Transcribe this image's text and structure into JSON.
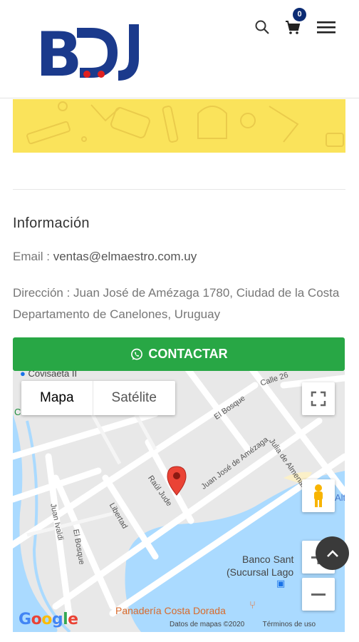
{
  "header": {
    "logo_text": "BDJ",
    "cart_count": "0",
    "icons": [
      "search-icon",
      "cart-icon",
      "hamburger-menu-icon"
    ],
    "brand_colors": {
      "navy": "#1b3a8c",
      "red": "#e0201f"
    }
  },
  "banner": {
    "color": "#fae35b"
  },
  "info": {
    "title": "Información",
    "email_label": "Email : ",
    "email": "ventas@elmaestro.com.uy",
    "address_label": "Dirección : ",
    "address": "Juan José de Amézaga 1780, Ciudad de la Costa Departamento de Canelones, Uruguay"
  },
  "contact": {
    "label": "CONTACTAR",
    "icon": "whatsapp-icon",
    "color": "#28a745"
  },
  "map": {
    "type_options": [
      "Mapa",
      "Satélite"
    ],
    "selected_type": "Mapa",
    "streets": {
      "s1": "Calle 26",
      "s2": "El Bosque",
      "s3": "Julia de Almenara",
      "s4": "Juan José de Amézaga",
      "s5": "Raúl Jude",
      "s6": "Juan Ivaldi",
      "s7": "Libertad",
      "s8": "El Bosque"
    },
    "places": {
      "p1": "Covisaeta II",
      "p2": "Costa",
      "p3": "Banco Sant",
      "p4": "(Sucursal Lago",
      "p5": "Panadería Costa Dorada",
      "p6": "Alt"
    },
    "logo": "Google",
    "attribution": "Datos de mapas ©2020",
    "terms": "Términos de uso"
  }
}
